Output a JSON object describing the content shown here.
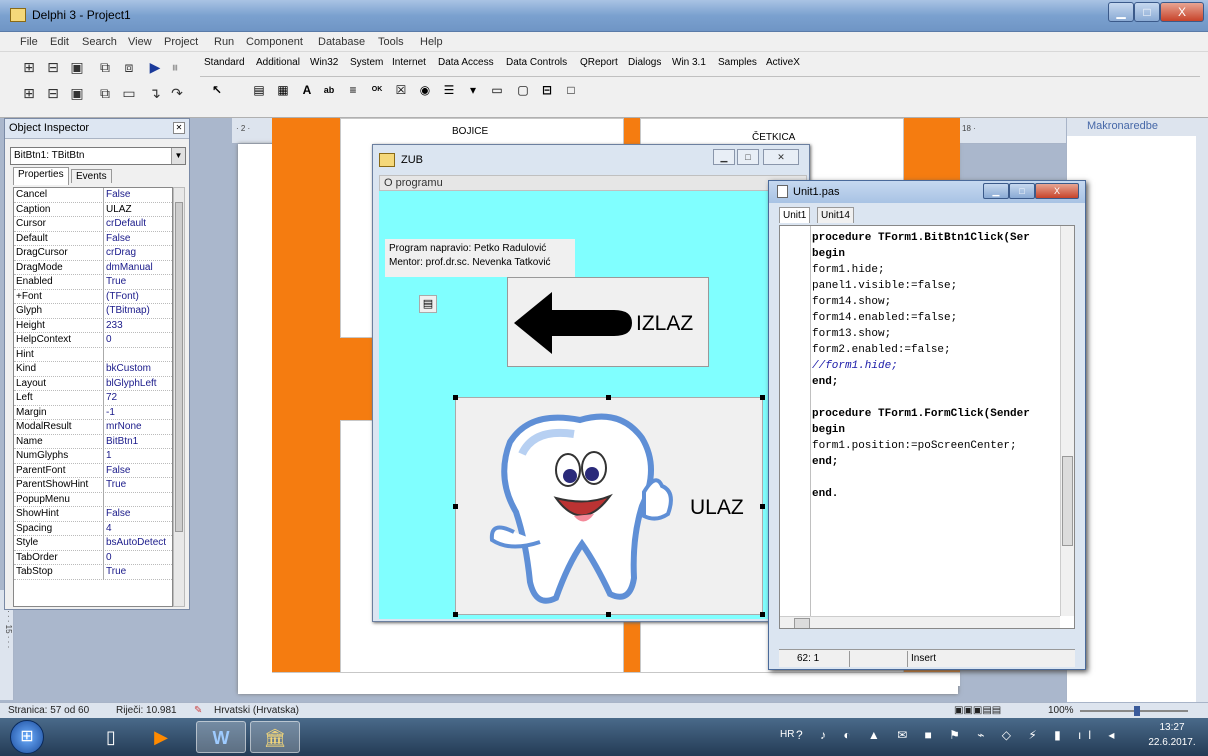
{
  "app": {
    "title": "Delphi 3 - Project1",
    "window_controls": {
      "minimize": "▁",
      "maximize": "□",
      "close": "X"
    }
  },
  "menu": [
    "File",
    "Edit",
    "Search",
    "View",
    "Project",
    "Run",
    "Component",
    "Database",
    "Tools",
    "Help"
  ],
  "speedbar_icons": [
    "open-project-icon",
    "open-file-icon",
    "save-all-icon",
    "open-unit-icon",
    "new-form-icon",
    "run-icon",
    "pause-icon",
    "save-icon",
    "add-file-icon",
    "remove-file-icon",
    "view-form-icon",
    "toggle-form-icon",
    "trace-into-icon",
    "step-over-icon"
  ],
  "palette": {
    "tabs": [
      "Standard",
      "Additional",
      "Win32",
      "System",
      "Internet",
      "Data Access",
      "Data Controls",
      "QReport",
      "Dialogs",
      "Win 3.1",
      "Samples",
      "ActiveX"
    ],
    "components": [
      {
        "name": "pointer-icon",
        "glyph": "↖"
      },
      {
        "name": "mainmenu-icon",
        "glyph": "▤"
      },
      {
        "name": "popupmenu-icon",
        "glyph": "▦"
      },
      {
        "name": "label-icon",
        "glyph": "A"
      },
      {
        "name": "edit-icon",
        "glyph": "ab"
      },
      {
        "name": "memo-icon",
        "glyph": "≡"
      },
      {
        "name": "button-icon",
        "glyph": "OK"
      },
      {
        "name": "checkbox-icon",
        "glyph": "☒"
      },
      {
        "name": "radiobutton-icon",
        "glyph": "◉"
      },
      {
        "name": "listbox-icon",
        "glyph": "☰"
      },
      {
        "name": "combobox-icon",
        "glyph": "▾"
      },
      {
        "name": "scrollbar-icon",
        "glyph": "▭"
      },
      {
        "name": "groupbox-icon",
        "glyph": "▢"
      },
      {
        "name": "radiogroup-icon",
        "glyph": "⊟"
      },
      {
        "name": "panel-icon",
        "glyph": "□"
      }
    ]
  },
  "inspector": {
    "title": "Object Inspector",
    "selected_object": "BitBtn1: TBitBtn",
    "tabs": [
      "Properties",
      "Events"
    ],
    "properties": [
      [
        "Cancel",
        "False"
      ],
      [
        "Caption",
        "ULAZ"
      ],
      [
        "Cursor",
        "crDefault"
      ],
      [
        "Default",
        "False"
      ],
      [
        "DragCursor",
        "crDrag"
      ],
      [
        "DragMode",
        "dmManual"
      ],
      [
        "Enabled",
        "True"
      ],
      [
        "+Font",
        "(TFont)"
      ],
      [
        "Glyph",
        "(TBitmap)"
      ],
      [
        "Height",
        "233"
      ],
      [
        "HelpContext",
        "0"
      ],
      [
        "Hint",
        ""
      ],
      [
        "Kind",
        "bkCustom"
      ],
      [
        "Layout",
        "blGlyphLeft"
      ],
      [
        "Left",
        "72"
      ],
      [
        "Margin",
        "-1"
      ],
      [
        "ModalResult",
        "mrNone"
      ],
      [
        "Name",
        "BitBtn1"
      ],
      [
        "NumGlyphs",
        "1"
      ],
      [
        "ParentFont",
        "False"
      ],
      [
        "ParentShowHint",
        "True"
      ],
      [
        "PopupMenu",
        ""
      ],
      [
        "ShowHint",
        "False"
      ],
      [
        "Spacing",
        "4"
      ],
      [
        "Style",
        "bsAutoDetect"
      ],
      [
        "TabOrder",
        "0"
      ],
      [
        "TabStop",
        "True"
      ]
    ],
    "selected_row": 1
  },
  "background": {
    "bojice": "BOJICE",
    "cetkica": "ČETKICA",
    "makronaredbe": "Makronaredbe",
    "ruler_marks": [
      "· 2 ·",
      "18 ·"
    ],
    "vruler": "· 14 · · · 15 · · ·"
  },
  "zub_form": {
    "title": "ZUB",
    "menu_item": "O programu",
    "credits_line1": "Program napravio: Petko Radulović",
    "credits_line2": "Mentor:  prof.dr.sc. Nevenka Tatković",
    "exit_label": "IZLAZ",
    "enter_label": "ULAZ",
    "small_button_glyph": "▤"
  },
  "editor": {
    "title": "Unit1.pas",
    "tabs": [
      "Unit1",
      "Unit14"
    ],
    "code": [
      {
        "text": "procedure TForm1.BitBtn1Click(Ser",
        "style": "kw"
      },
      {
        "text": "begin",
        "style": "kw"
      },
      {
        "text": "form1.hide;",
        "style": ""
      },
      {
        "text": "panel1.visible:=false;",
        "style": ""
      },
      {
        "text": "form14.show;",
        "style": ""
      },
      {
        "text": "form14.enabled:=false;",
        "style": ""
      },
      {
        "text": "form13.show;",
        "style": ""
      },
      {
        "text": "form2.enabled:=false;",
        "style": ""
      },
      {
        "text": "//form1.hide;",
        "style": "comment"
      },
      {
        "text": "end;",
        "style": "kw"
      },
      {
        "text": "",
        "style": ""
      },
      {
        "text": "procedure TForm1.FormClick(Sender",
        "style": "kw"
      },
      {
        "text": "begin",
        "style": "kw"
      },
      {
        "text": "form1.position:=poScreenCenter;",
        "style": ""
      },
      {
        "text": "end;",
        "style": "kw"
      },
      {
        "text": "",
        "style": ""
      },
      {
        "text": "end.",
        "style": "kw"
      }
    ],
    "status_position": "62:  1",
    "status_mode": "Insert"
  },
  "word_status": {
    "page": "Stranica: 57 od 60",
    "words": "Riječi: 10.981",
    "language": "Hrvatski (Hrvatska)",
    "zoom": "100%"
  },
  "taskbar": {
    "apps": [
      {
        "name": "explorer-taskbar-icon",
        "glyph": "▯"
      },
      {
        "name": "media-player-taskbar-icon",
        "glyph": "▶"
      },
      {
        "name": "word-taskbar-icon",
        "glyph": "W"
      },
      {
        "name": "delphi-taskbar-icon",
        "glyph": "🏛"
      }
    ],
    "lang": "HR",
    "tray": "?  ♪ ◐ ▲ ✉ ■ ⚑ ⌁ ◇ ⚡ ▮ ıl ◂",
    "time": "13:27",
    "date": "22.6.2017."
  }
}
